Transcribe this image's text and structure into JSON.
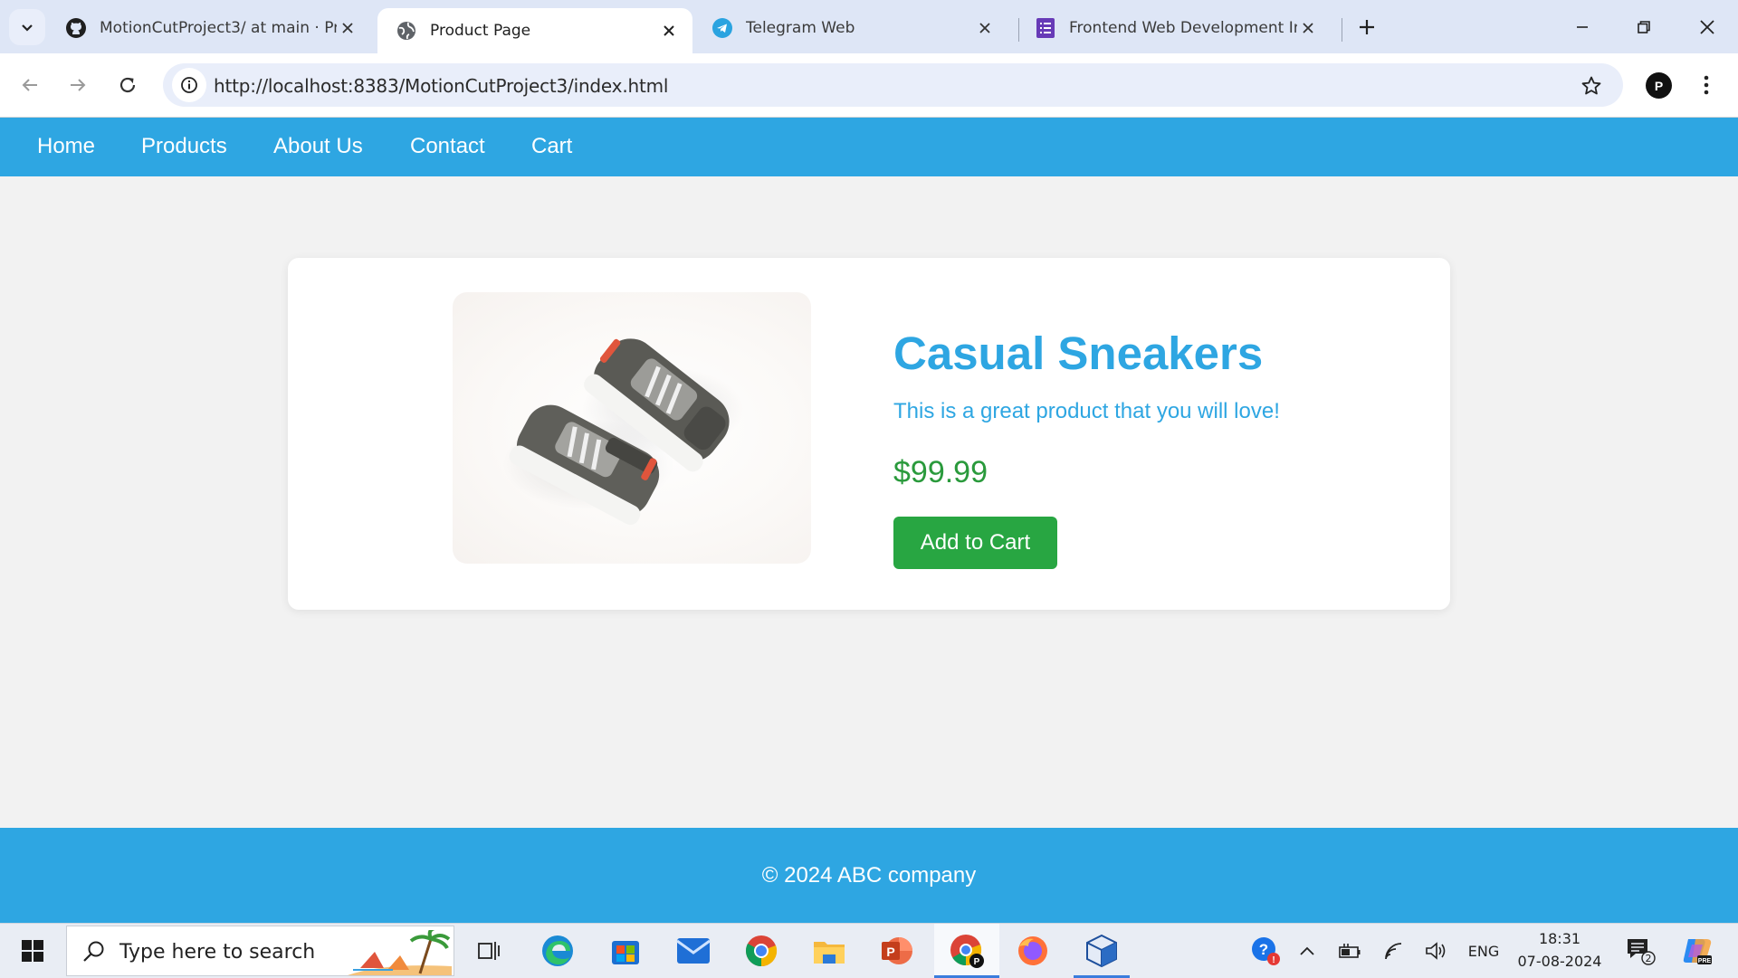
{
  "browser": {
    "tabs": [
      {
        "title": "MotionCutProject3/ at main · Pr",
        "icon": "github-icon",
        "active": false
      },
      {
        "title": "Product Page",
        "icon": "globe-icon",
        "active": true
      },
      {
        "title": "Telegram Web",
        "icon": "telegram-icon",
        "active": false
      },
      {
        "title": "Frontend Web Development Int",
        "icon": "form-icon",
        "active": false
      }
    ],
    "url": "http://localhost:8383/MotionCutProject3/index.html",
    "profile_initial": "P"
  },
  "site": {
    "nav": [
      "Home",
      "Products",
      "About Us",
      "Contact",
      "Cart"
    ],
    "product": {
      "title": "Casual Sneakers",
      "description": "This is a great product that you will love!",
      "price": "$99.99",
      "button": "Add to Cart",
      "image": "sneakers-photo"
    },
    "footer": "© 2024 ABC company"
  },
  "taskbar": {
    "search_placeholder": "Type here to search",
    "apps": [
      "task-view-icon",
      "edge-icon",
      "store-icon",
      "mail-icon",
      "chrome-icon",
      "file-explorer-icon",
      "powerpoint-icon",
      "chrome-profile-icon",
      "firefox-icon",
      "box-app-icon"
    ],
    "language": "ENG",
    "time": "18:31",
    "date": "07-08-2024",
    "notification_count": "2"
  },
  "colors": {
    "brand": "#2ea6e2",
    "price": "#2a9a3c",
    "button": "#28a642",
    "page_bg": "#f2f2f2"
  }
}
